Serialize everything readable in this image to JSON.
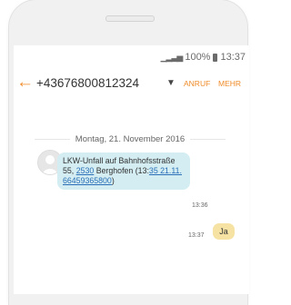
{
  "status_bar": {
    "signal_icon": "signal-icon",
    "battery_percent": "100%",
    "battery_icon": "battery-icon",
    "time": "13:37"
  },
  "header": {
    "back_icon": "arrow-left-icon",
    "contact": "+43676800812324",
    "dropdown_icon": "triangle-down-icon",
    "call_label": "ANRUF",
    "more_label": "MEHR"
  },
  "conversation": {
    "date": "Montag, 21. November 2016",
    "incoming": {
      "avatar_icon": "person-avatar-icon",
      "text_before": "LKW-Unfall auf Bahnhofsstraße 55, ",
      "link_postal": "2530",
      "text_middle": " Berghofen (13:",
      "link_number": "35 21.11. 66459365800",
      "text_after": ")",
      "time": "13:36"
    },
    "outgoing": {
      "text": "Ja",
      "time": "13:37"
    }
  },
  "colors": {
    "accent": "#f08c2a",
    "incoming_bubble": "#d3edf2",
    "outgoing_bubble": "#f6e3a4",
    "link": "#2a6fb7"
  }
}
